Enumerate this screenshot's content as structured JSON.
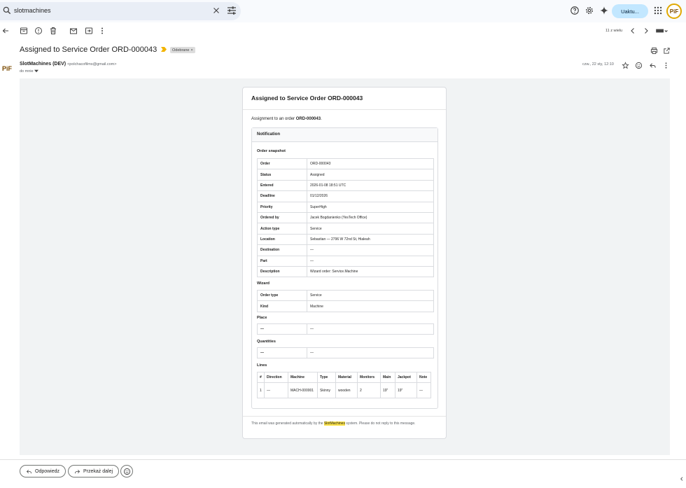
{
  "search": {
    "query": "slotmachines"
  },
  "topbar": {
    "upgrade_label": "Uaktu..."
  },
  "toolbar": {
    "pager": "11 z wielu"
  },
  "message": {
    "subject": "Assigned to Service Order ORD-000043",
    "label": "Odebrane",
    "label_close": "×",
    "sender_name": "SlotMachines (DEV)",
    "sender_email": "<polchacofilms@gmail.com>",
    "to": "do mnie",
    "date": "czw., 22 sty, 12:10"
  },
  "email": {
    "title": "Assigned to Service Order ORD-000043",
    "intro_prefix": "Assignment to an order ",
    "intro_order": "ORD-000043",
    "intro_suffix": ".",
    "notification_title": "Notification",
    "snapshot_title": "Order snapshot",
    "snapshot": [
      {
        "k": "Order",
        "v": "ORD-000043"
      },
      {
        "k": "Status",
        "v": "Assigned"
      },
      {
        "k": "Entered",
        "v": "2026-01-08 18:51 UTC"
      },
      {
        "k": "Deadline",
        "v": "01/12/2026"
      },
      {
        "k": "Priority",
        "v": "SuperHigh"
      },
      {
        "k": "Ordered by",
        "v": "Jacek Bogdanienko (YesTech Office)"
      },
      {
        "k": "Action type",
        "v": "Service"
      },
      {
        "k": "Location",
        "v": "Sebastian — 2796 W 72nd St, Hialeah"
      },
      {
        "k": "Destination",
        "v": "—"
      },
      {
        "k": "Part",
        "v": "—"
      },
      {
        "k": "Description",
        "v": "Wizard order: Service.Machine"
      }
    ],
    "wizard_title": "Wizard",
    "wizard": [
      {
        "k": "Order type",
        "v": "Service"
      },
      {
        "k": "Kind",
        "v": "Machine"
      }
    ],
    "place_title": "Place",
    "place": [
      {
        "k": "—",
        "v": "—"
      }
    ],
    "quantities_title": "Quantities",
    "quantities": [
      {
        "k": "—",
        "v": "—"
      }
    ],
    "lines_title": "Lines",
    "lines_headers": [
      "#",
      "Direction",
      "Machine",
      "Type",
      "Material",
      "Monitors",
      "Main",
      "Jackpot",
      "Note"
    ],
    "lines_rows": [
      [
        "1",
        "—",
        "MACH-000001",
        "Skinny",
        "wooden",
        "2",
        "19\"",
        "19\"",
        "—"
      ]
    ],
    "footer_prefix": "This email was generated automatically by the ",
    "footer_highlight": "SlotMachines",
    "footer_suffix": " system. Please do not reply to this message."
  },
  "actions": {
    "reply": "Odpowiedz",
    "forward": "Przekaż dalej"
  },
  "avatar_text": "PiF",
  "colors": {
    "accent": "#c2e7ff",
    "highlight": "#fce34a",
    "body_bg": "#f1f3f4",
    "important": "#f2b400"
  }
}
